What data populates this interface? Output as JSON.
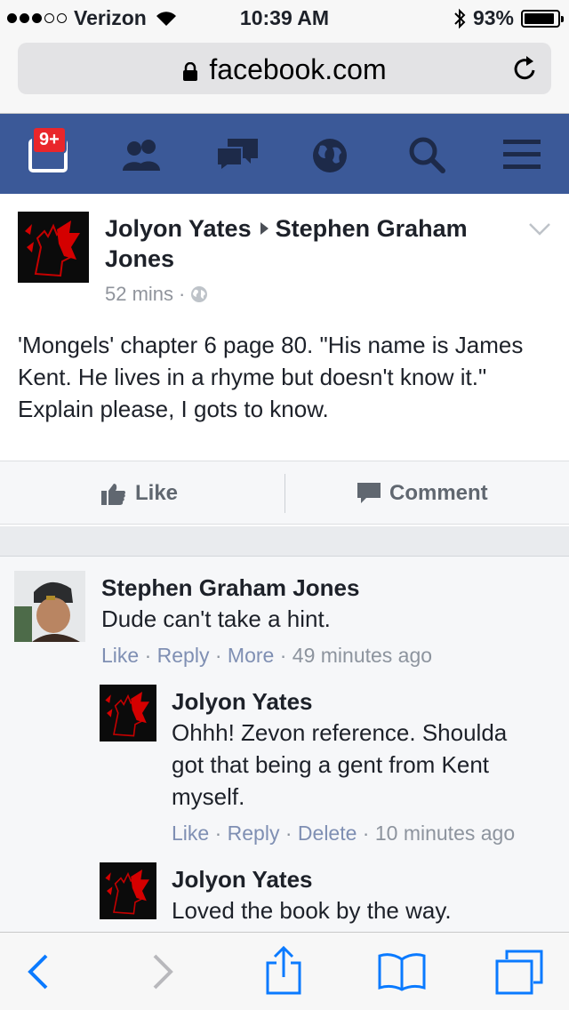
{
  "status": {
    "carrier": "Verizon",
    "time": "10:39 AM",
    "battery": "93%",
    "battery_level": 0.93
  },
  "browser": {
    "url": "facebook.com"
  },
  "fb_nav": {
    "notifications_badge": "9+",
    "icons": [
      "notifications-icon",
      "friends-icon",
      "messages-icon",
      "globe-icon",
      "search-icon",
      "menu-icon"
    ]
  },
  "post": {
    "author": "Jolyon Yates",
    "target": "Stephen Graham Jones",
    "time": "52 mins",
    "body": "'Mongels' chapter 6 page 80. \"His name is James Kent. He lives in a rhyme but doesn't know it.\" Explain please, I gots to know.",
    "like_label": "Like",
    "comment_label": "Comment"
  },
  "comments": [
    {
      "name": "Stephen Graham Jones",
      "text": "Dude can't take a hint.",
      "actions": [
        "Like",
        "Reply",
        "More"
      ],
      "time": "49 minutes ago"
    },
    {
      "name": "Jolyon Yates",
      "text": "Ohhh! Zevon reference. Shoulda got that being a gent from Kent myself.",
      "actions": [
        "Like",
        "Reply",
        "Delete"
      ],
      "time": "10 minutes ago"
    },
    {
      "name": "Jolyon Yates",
      "text": "Loved the book by the way."
    }
  ],
  "colors": {
    "fb_blue": "#3b5998",
    "badge_red": "#e9262b",
    "ios_blue": "#0a7aff"
  }
}
